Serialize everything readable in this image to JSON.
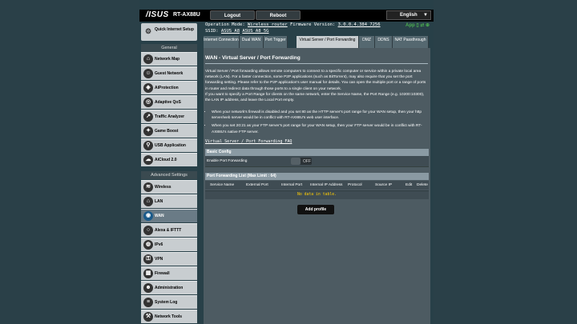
{
  "header": {
    "brand": "/ISUS",
    "model": "RT-AX88U",
    "logout_label": "Logout",
    "reboot_label": "Reboot",
    "language": "English"
  },
  "status": {
    "op_mode_label": "Operation Mode:",
    "op_mode_value": "Wireless router",
    "firmware_label": "Firmware Version:",
    "firmware_value": "3.0.0.4.384_7256",
    "ssid_label": "SSID:",
    "ssid_1": "ASUS_A8",
    "ssid_2": "ASUS_A8_5G",
    "app_label": "App"
  },
  "sidebar": {
    "quick_setup": "Quick Internet Setup",
    "general_header": "General",
    "general_items": [
      {
        "label": "Network Map",
        "icon": "network-map-icon"
      },
      {
        "label": "Guest Network",
        "icon": "guest-network-icon"
      },
      {
        "label": "AiProtection",
        "icon": "aiprotection-icon"
      },
      {
        "label": "Adaptive QoS",
        "icon": "qos-icon"
      },
      {
        "label": "Traffic Analyzer",
        "icon": "traffic-analyzer-icon"
      },
      {
        "label": "Game Boost",
        "icon": "game-boost-icon"
      },
      {
        "label": "USB Application",
        "icon": "usb-icon"
      },
      {
        "label": "AiCloud 2.0",
        "icon": "aicloud-icon"
      }
    ],
    "advanced_header": "Advanced Settings",
    "advanced_items": [
      {
        "label": "Wireless",
        "icon": "wireless-icon"
      },
      {
        "label": "LAN",
        "icon": "lan-icon"
      },
      {
        "label": "WAN",
        "icon": "wan-icon"
      },
      {
        "label": "Alexa & IFTTT",
        "icon": "alexa-icon"
      },
      {
        "label": "IPv6",
        "icon": "ipv6-icon"
      },
      {
        "label": "VPN",
        "icon": "vpn-icon"
      },
      {
        "label": "Firewall",
        "icon": "firewall-icon"
      },
      {
        "label": "Administration",
        "icon": "administration-icon"
      },
      {
        "label": "System Log",
        "icon": "system-log-icon"
      },
      {
        "label": "Network Tools",
        "icon": "network-tools-icon"
      }
    ]
  },
  "tabs": [
    {
      "label": "Internet Connection"
    },
    {
      "label": "Dual WAN"
    },
    {
      "label": "Port Trigger"
    },
    {
      "label": "Virtual Server / Port Forwarding"
    },
    {
      "label": "DMZ"
    },
    {
      "label": "DDNS"
    },
    {
      "label": "NAT Passthrough"
    }
  ],
  "main": {
    "title": "WAN - Virtual Server / Port Forwarding",
    "description": "Virtual Server / Port forwarding allows remote computers to connect to a specific computer or service within a private local area network (LAN). For a faster connection, some P2P applications (such as BitTorrent), may also require that you set the port forwarding setting. Please refer to the P2P application's user manual for details. You can open the multiple port or a range of ports in router and redirect data through those ports to a single client on your network.",
    "description_2": "If you want to specify a Port Range for clients on the same network, enter the Service Name, the Port Range (e.g. 10200:10300), the LAN IP address, and leave the Local Port empty.",
    "bullet_1": "When your network's firewall is disabled and you set 80 as the HTTP server's port range for your WAN setup, then your http server/web server would be in conflict with RT-AX88U's web user interface.",
    "bullet_2": "When you set 20:21 as your FTP server's port range for your WAN setup, then your FTP server would be in conflict with RT-AX88U's native FTP server.",
    "faq_link": "Virtual Server / Port Forwarding FAQ",
    "basic_config_header": "Basic Config",
    "enable_label": "Enable Port Forwarding",
    "enable_state": "OFF",
    "list_header": "Port Forwarding List (Max Limit : 64)",
    "columns": [
      "Service Name",
      "External Port",
      "Internal Port",
      "Internal IP Address",
      "Protocol",
      "Source IP",
      "Edit",
      "Delete"
    ],
    "no_data": "No data in table.",
    "add_button": "Add profile"
  }
}
